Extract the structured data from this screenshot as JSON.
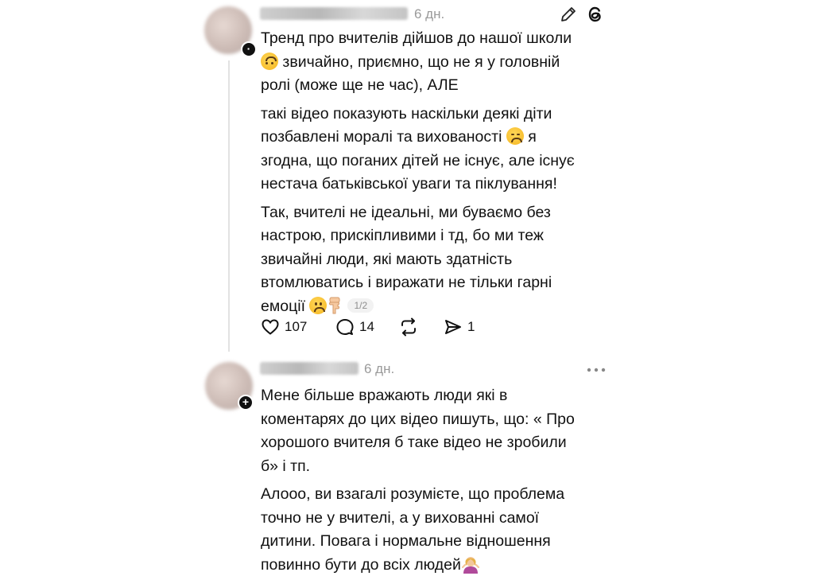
{
  "post1": {
    "timestamp": "6 дн.",
    "paragraphs": [
      [
        "Тренд про вчителів дійшов до нашої школи",
        "[upside] звичайно, приємно, що не я у головній",
        "ролі (може ще не час), АЛЕ"
      ],
      [
        "такі відео показують наскільки деякі діти",
        "позбавлені моралі та вихованості [sad] я",
        "згодна, що поганих дітей не існує, але існує",
        "нестача батьківської уваги та піклування!"
      ],
      [
        "Так, вчителі не ідеальні, ми буваємо без",
        "настрою, прискіпливими і тд, бо ми теж",
        "звичайні люди, які мають здатність",
        "втомлюватись і виражати не тільки гарні",
        "емоції [frown] [hand]"
      ]
    ],
    "lines": {
      "l1": "Тренд про вчителів дійшов до нашої школи",
      "l2": " звичайно, приємно, що не я у головній",
      "l3": "ролі (може ще не час), АЛЕ",
      "l4": "такі відео показують наскільки деякі діти",
      "l5a": "позбавлені моралі та вихованості ",
      "l5b": " я",
      "l6": "згодна, що поганих дітей не існує, але існує",
      "l7": "нестача батьківської уваги та піклування!",
      "l8": "Так, вчителі не ідеальні, ми буваємо без",
      "l9": "настрою, прискіпливими і тд, бо ми теж",
      "l10": "звичайні люди, які мають здатність",
      "l11": "втомлюватись і виражати не тільки гарні",
      "l12": "емоції "
    },
    "page_indicator": "1/2",
    "actions": {
      "likes": "107",
      "comments": "14",
      "shares": "1"
    },
    "icons": [
      "edit-icon",
      "threads-icon",
      "heart-icon",
      "comment-icon",
      "repost-icon",
      "share-icon",
      "upside-down-face-emoji",
      "sad-face-emoji",
      "frowning-face-emoji",
      "pointing-down-emoji"
    ]
  },
  "post2": {
    "timestamp": "6 дн.",
    "lines": {
      "l1": "Мене більше вражають люди які в",
      "l2": "коментарях до цих відео пишуть, що: « Про",
      "l3": "хорошого вчителя б таке відео не зробили",
      "l4": "б» і тп.",
      "l5": "Алооо, ви взагалі розумієте, що проблема",
      "l6": "точно не у вчителі, а у вихованні самої",
      "l7": "дитини. Повага і нормальне відношення",
      "l8": "повинно бути до всіх людей"
    },
    "icons": [
      "more-icon",
      "follow-plus-icon",
      "person-shrugging-emoji"
    ]
  },
  "colors": {
    "text": "#111111",
    "muted": "#9a9a9a",
    "thread_line": "#e2e2e2",
    "background": "#ffffff"
  }
}
